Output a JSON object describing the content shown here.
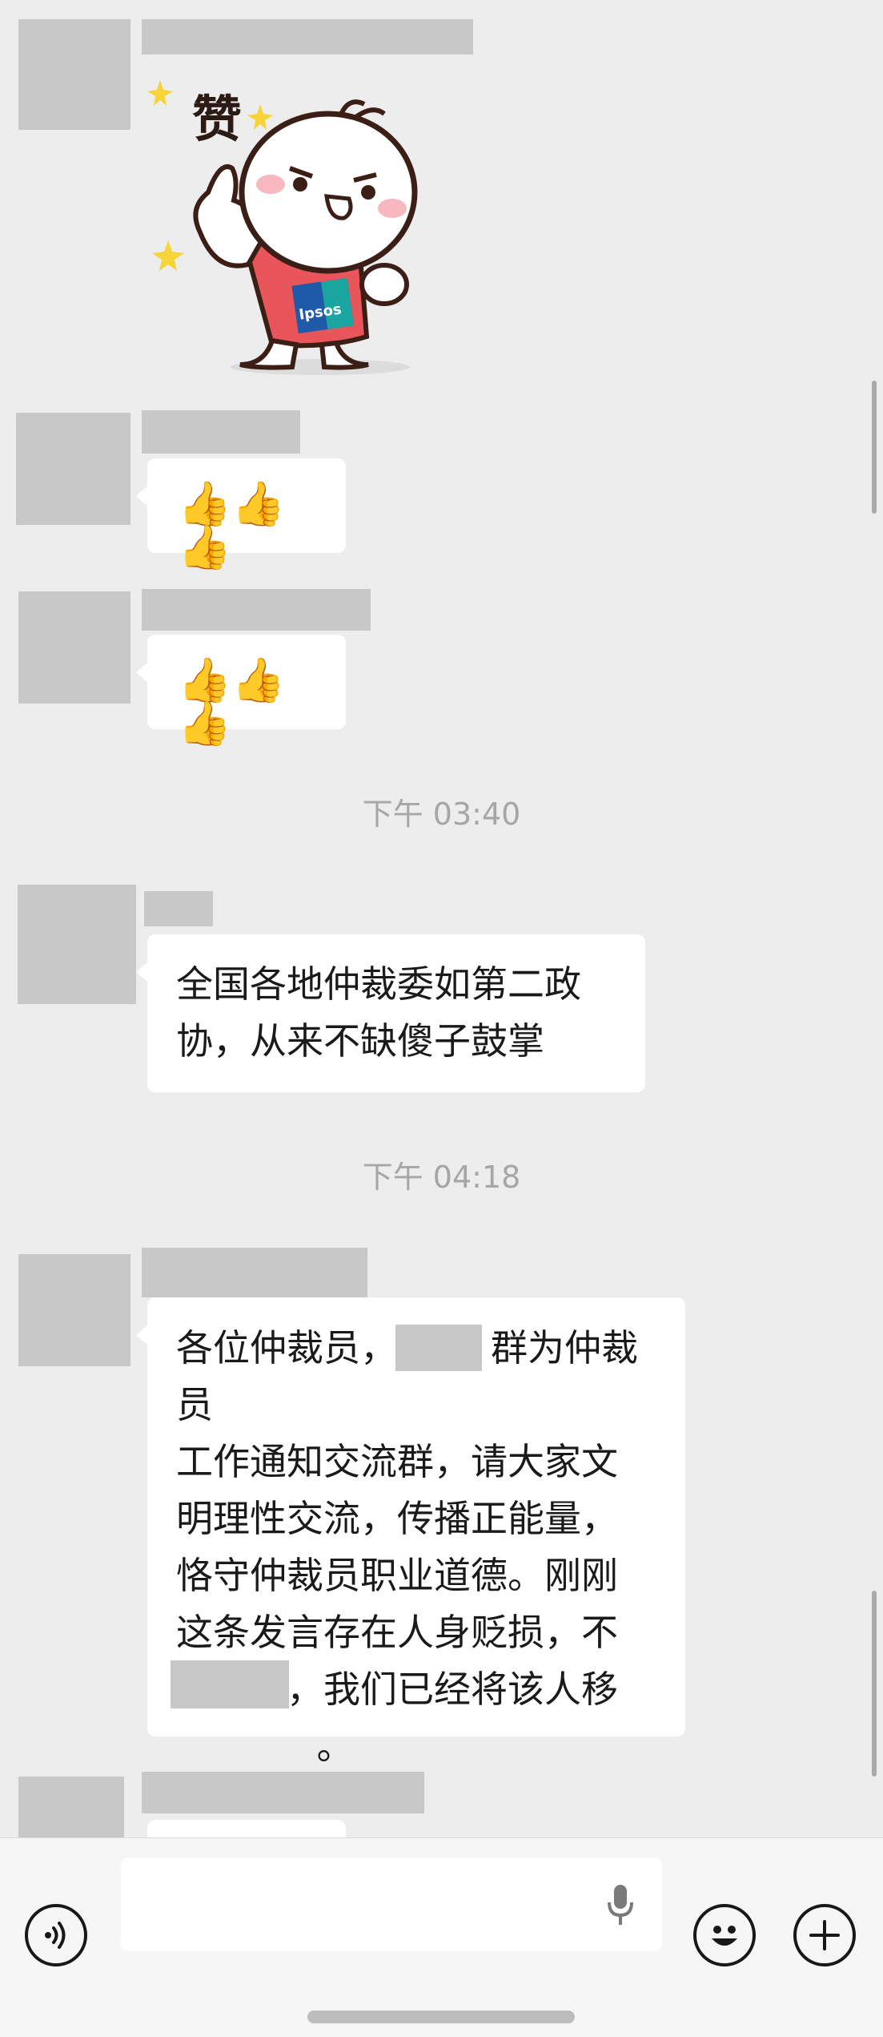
{
  "messages": [
    {
      "type": "sticker",
      "sticker_text": "赞",
      "shirt_logo": "Ipsos"
    },
    {
      "type": "emoji",
      "content": "👍👍👍"
    },
    {
      "type": "emoji",
      "content": "👍👍👍"
    },
    {
      "type": "timestamp",
      "text": "下午 03:40"
    },
    {
      "type": "text",
      "content": "全国各地仲裁委如第二政\n协，从来不缺傻子鼓掌"
    },
    {
      "type": "timestamp",
      "text": "下午 04:18"
    },
    {
      "type": "text",
      "content": "各位仲裁员，        群为仲裁员\n工作通知交流群，请大家文\n明理性交流，传播正能量，\n恪守仲裁员职业道德。刚刚\n这条发言存在人身贬损，不\n当言论，我们已经将该人移\n            。"
    }
  ],
  "input_bar": {
    "voice_icon": "voice-icon",
    "mic_icon": "microphone-icon",
    "emoji_icon": "emoji-icon",
    "add_icon": "plus-icon",
    "text_value": ""
  },
  "colors": {
    "background": "#ededed",
    "bubble": "#ffffff",
    "redaction": "#c8c8c8",
    "sticker_shirt": "#e8555a"
  }
}
